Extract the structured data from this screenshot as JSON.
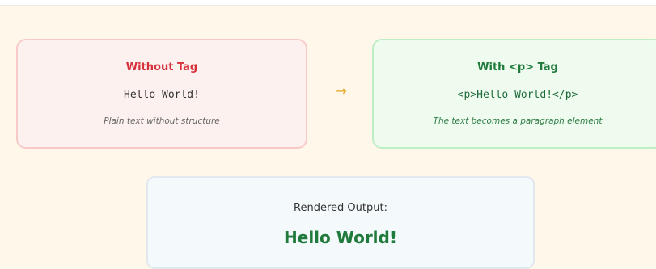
{
  "left_card": {
    "title": "Without Tag",
    "code": "Hello World!",
    "description": "Plain text without structure"
  },
  "arrow": "→",
  "right_card": {
    "title": "With <p> Tag",
    "code": "<p>Hello World!</p>",
    "description": "The text becomes a paragraph element"
  },
  "output": {
    "label": "Rendered Output:",
    "value": "Hello World!"
  },
  "colors": {
    "left_accent": "#d6303a",
    "right_accent": "#1f7a3c",
    "arrow": "#e0a419",
    "output_text": "#1f7a3c"
  }
}
